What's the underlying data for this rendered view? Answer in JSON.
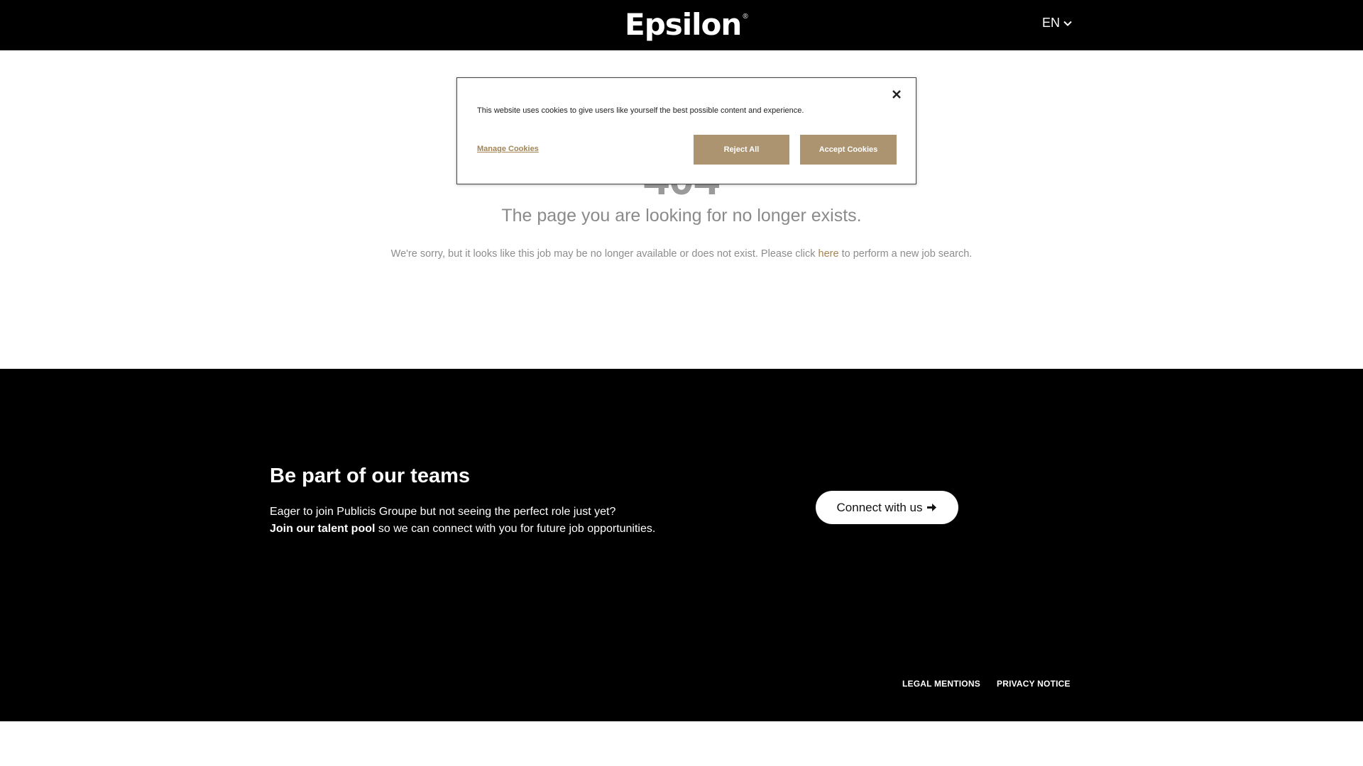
{
  "header": {
    "logo_text": "Epsilon",
    "logo_mark": "®",
    "language": "EN",
    "language_icon": "chevron-down-icon"
  },
  "error": {
    "code": "404",
    "title": "The page you are looking for no longer exists.",
    "desc_before": "We're sorry, but it looks like this job may be no longer available or does not exist. Please click ",
    "desc_link": "here",
    "desc_after": " to perform a new job search."
  },
  "cookie_banner": {
    "text": "This website uses cookies to give users like yourself the best possible content and experience.",
    "manage_label": "Manage Cookies",
    "reject_label": "Reject All",
    "accept_label": "Accept Cookies",
    "close_icon": "close-icon",
    "button_color": "#ac9470",
    "link_color": "#a38454"
  },
  "footer": {
    "cta_title": "Be part of our teams",
    "cta_line1": "Eager to join Publicis Groupe but not seeing the perfect role just yet?",
    "cta_line2_bold": "Join our talent pool",
    "cta_line2_rest": " so we can connect with you for future job opportunities.",
    "connect_label": "Connect with us",
    "connect_icon": "arrow-right-icon",
    "legal_label": "LEGAL MENTIONS",
    "privacy_label": "PRIVACY NOTICE"
  }
}
